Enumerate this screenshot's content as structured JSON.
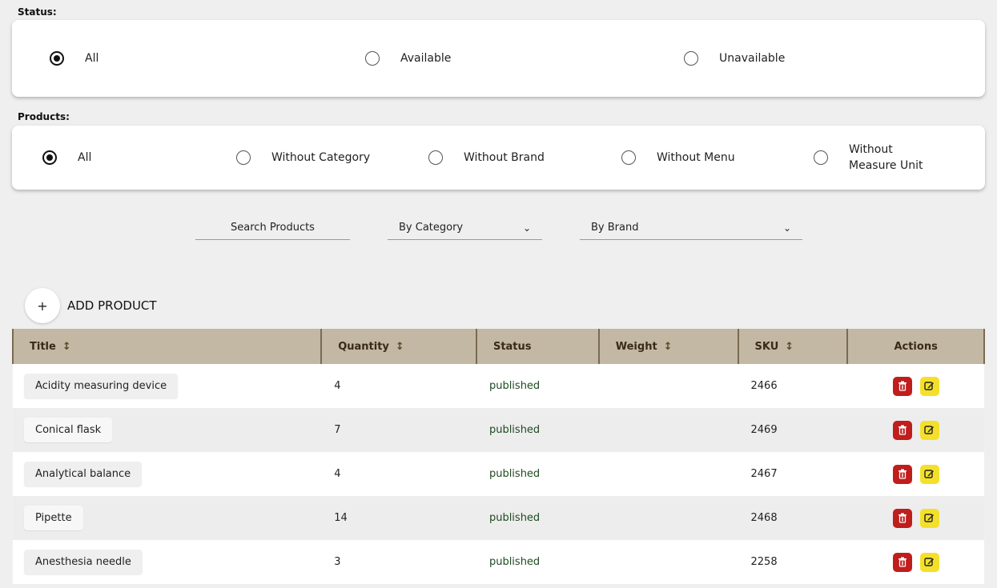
{
  "status_section": {
    "label": "Status:",
    "options": [
      {
        "label": "All",
        "checked": true
      },
      {
        "label": "Available",
        "checked": false
      },
      {
        "label": "Unavailable",
        "checked": false
      }
    ]
  },
  "products_section": {
    "label": "Products:",
    "options": [
      {
        "label": "All",
        "checked": true
      },
      {
        "label": "Without Category",
        "checked": false
      },
      {
        "label": "Without Brand",
        "checked": false
      },
      {
        "label": "Without Menu",
        "checked": false
      },
      {
        "label": "Without Measure Unit",
        "checked": false
      }
    ]
  },
  "filters": {
    "search_placeholder": "Search Products",
    "category_select": "By Category",
    "brand_select": "By Brand"
  },
  "add_product": {
    "icon": "+",
    "label": "ADD PRODUCT"
  },
  "table": {
    "headers": {
      "title": "Title",
      "quantity": "Quantity",
      "status": "Status",
      "weight": "Weight",
      "sku": "SKU",
      "actions": "Actions"
    },
    "rows": [
      {
        "title": "Acidity measuring device",
        "quantity": "4",
        "status": "published",
        "weight": "",
        "sku": "2466"
      },
      {
        "title": "Conical flask",
        "quantity": "7",
        "status": "published",
        "weight": "",
        "sku": "2469"
      },
      {
        "title": "Analytical balance",
        "quantity": "4",
        "status": "published",
        "weight": "",
        "sku": "2467"
      },
      {
        "title": "Pipette",
        "quantity": "14",
        "status": "published",
        "weight": "",
        "sku": "2468"
      },
      {
        "title": "Anesthesia needle",
        "quantity": "3",
        "status": "published",
        "weight": "",
        "sku": "2258"
      }
    ]
  },
  "colors": {
    "header_bg": "#c2b8a3",
    "delete": "#c01d1d",
    "edit": "#f4e02a"
  }
}
